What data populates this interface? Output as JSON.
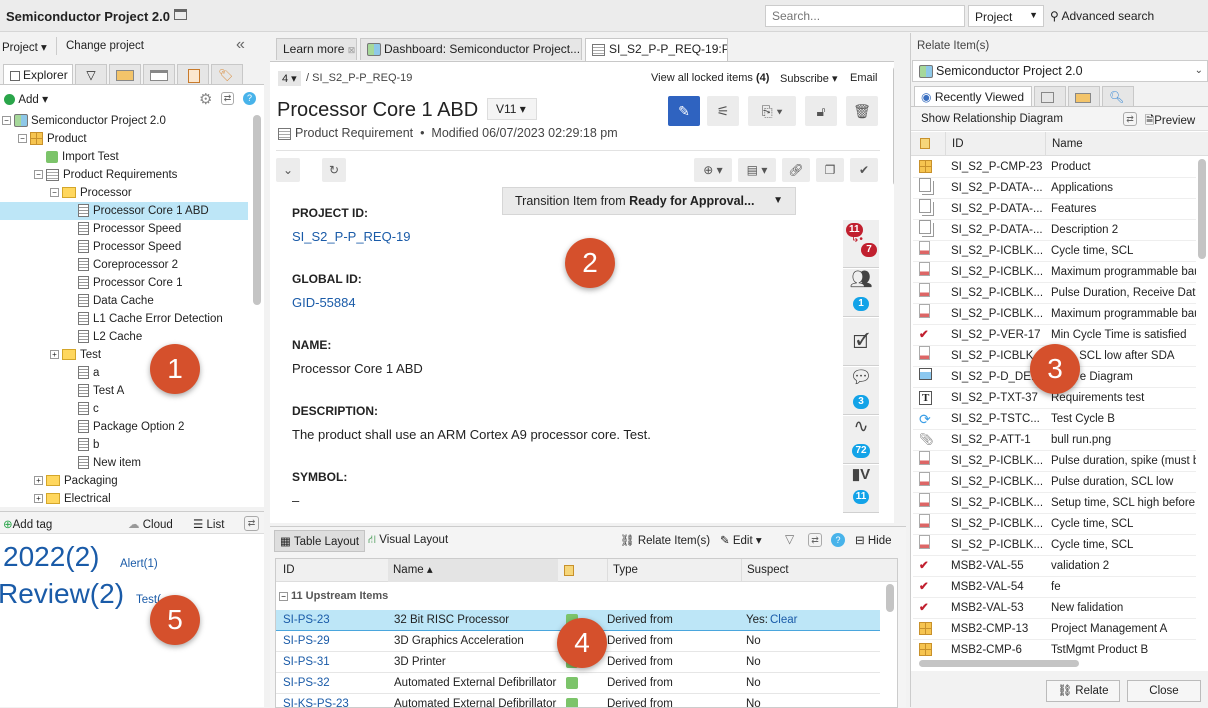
{
  "app": {
    "title": "Semiconductor Project 2.0",
    "search_placeholder": "Search...",
    "scope": "Project",
    "advanced_search": "Advanced search"
  },
  "left": {
    "project_menu": "Project",
    "change_project": "Change project",
    "tabs": [
      {
        "label": "Explorer"
      }
    ],
    "add": "Add",
    "tree": [
      {
        "label": "Semiconductor Project 2.0",
        "level": 0,
        "icon": "project",
        "toggle": "-"
      },
      {
        "label": "Product",
        "level": 1,
        "icon": "component",
        "toggle": "-"
      },
      {
        "label": "Import Test",
        "level": 2,
        "icon": "puzzle",
        "toggle": ""
      },
      {
        "label": "Product Requirements",
        "level": 2,
        "icon": "requirement",
        "toggle": "-"
      },
      {
        "label": "Processor",
        "level": 3,
        "icon": "folder",
        "toggle": "-"
      },
      {
        "label": "Processor Core 1 ABD",
        "level": 4,
        "icon": "doc",
        "toggle": "",
        "selected": true
      },
      {
        "label": "Processor Speed",
        "level": 4,
        "icon": "doc",
        "toggle": ""
      },
      {
        "label": "Processor Speed",
        "level": 4,
        "icon": "doc",
        "toggle": ""
      },
      {
        "label": "Coreprocessor 2",
        "level": 4,
        "icon": "doc",
        "toggle": ""
      },
      {
        "label": "Processor Core 1",
        "level": 4,
        "icon": "doc",
        "toggle": ""
      },
      {
        "label": "Data Cache",
        "level": 4,
        "icon": "doc",
        "toggle": ""
      },
      {
        "label": "L1 Cache Error Detection",
        "level": 4,
        "icon": "doc",
        "toggle": ""
      },
      {
        "label": "L2 Cache",
        "level": 4,
        "icon": "doc",
        "toggle": ""
      },
      {
        "label": "Test",
        "level": 3,
        "icon": "folder",
        "toggle": "+"
      },
      {
        "label": "a",
        "level": 4,
        "icon": "doc",
        "toggle": ""
      },
      {
        "label": "Test A",
        "level": 4,
        "icon": "doc",
        "toggle": ""
      },
      {
        "label": "c",
        "level": 4,
        "icon": "doc",
        "toggle": ""
      },
      {
        "label": "Package Option 2",
        "level": 4,
        "icon": "doc",
        "toggle": ""
      },
      {
        "label": "b",
        "level": 4,
        "icon": "doc",
        "toggle": ""
      },
      {
        "label": "New item",
        "level": 4,
        "icon": "doc",
        "toggle": ""
      },
      {
        "label": "Packaging",
        "level": 2,
        "icon": "folder",
        "toggle": "+"
      },
      {
        "label": "Electrical",
        "level": 2,
        "icon": "folder",
        "toggle": "+"
      }
    ]
  },
  "tags": {
    "add_tag": "Add tag",
    "cloud": "Cloud",
    "list": "List",
    "items": [
      {
        "label": "2022(2)"
      },
      {
        "label": "Alert(1)"
      },
      {
        "label": "Review(2)"
      },
      {
        "label": "Test("
      }
    ]
  },
  "center": {
    "tabs": [
      {
        "label": "Learn more"
      },
      {
        "label": "Dashboard: Semiconductor Project..."
      },
      {
        "label": "SI_S2_P-P_REQ-19:Proce..."
      }
    ],
    "crumb_count": "4",
    "crumb": "SI_S2_P-P_REQ-19",
    "locked": "View all locked items",
    "locked_count": "(4)",
    "subscribe": "Subscribe",
    "email": "Email",
    "title": "Processor Core 1 ABD",
    "version": "V11",
    "item_type": "Product Requirement",
    "modified": "Modified 06/07/2023 02:29:18 pm",
    "transition_prefix": "Transition Item from ",
    "transition_state": "Ready for Approval...",
    "fields": [
      {
        "label": "PROJECT ID:",
        "value": "SI_S2_P-P_REQ-19",
        "link": true
      },
      {
        "label": "GLOBAL ID:",
        "value": "GID-55884",
        "link": true
      },
      {
        "label": "NAME:",
        "value": "Processor Core 1 ABD"
      },
      {
        "label": "DESCRIPTION:",
        "value": "The product shall use an ARM Cortex A9 processor core. Test."
      },
      {
        "label": "SYMBOL:",
        "value": "–"
      }
    ],
    "side_badges": {
      "upstream": "11",
      "downstream": "7",
      "users": "1",
      "comments": "3",
      "activity": "72",
      "versions": "11"
    }
  },
  "relations": {
    "table_layout": "Table Layout",
    "visual_layout": "Visual Layout",
    "relate": "Relate Item(s)",
    "edit": "Edit",
    "hide": "Hide",
    "columns": [
      "ID",
      "Name",
      "Type",
      "Suspect"
    ],
    "group": "11 Upstream Items",
    "rows": [
      {
        "id": "SI-PS-23",
        "name": "32 Bit RISC Processor",
        "type": "Derived from",
        "suspect": "Yes:",
        "clear": "Clear",
        "selected": true
      },
      {
        "id": "SI-PS-29",
        "name": "3D Graphics Acceleration",
        "type": "Derived from",
        "suspect": "No"
      },
      {
        "id": "SI-PS-31",
        "name": "3D Printer",
        "type": "Derived from",
        "suspect": "No"
      },
      {
        "id": "SI-PS-32",
        "name": "Automated External Defibrillator",
        "type": "Derived from",
        "suspect": "No"
      },
      {
        "id": "SI-KS-PS-23",
        "name": "Automated External Defibrillator",
        "type": "Derived from",
        "suspect": "No"
      }
    ]
  },
  "right": {
    "title": "Relate Item(s)",
    "project": "Semiconductor Project 2.0",
    "tab": "Recently Viewed",
    "show_diagram": "Show Relationship Diagram",
    "preview": "Preview",
    "columns": [
      "ID",
      "Name"
    ],
    "rows": [
      {
        "icon": "component",
        "id": "SI_S2_P-CMP-23",
        "name": "Product"
      },
      {
        "icon": "data",
        "id": "SI_S2_P-DATA-...",
        "name": "Applications"
      },
      {
        "icon": "data",
        "id": "SI_S2_P-DATA-...",
        "name": "Features"
      },
      {
        "icon": "data",
        "id": "SI_S2_P-DATA-...",
        "name": "Description 2"
      },
      {
        "icon": "block",
        "id": "SI_S2_P-ICBLK...",
        "name": "Cycle time, SCL"
      },
      {
        "icon": "block",
        "id": "SI_S2_P-ICBLK...",
        "name": "Maximum programmable bau"
      },
      {
        "icon": "block",
        "id": "SI_S2_P-ICBLK...",
        "name": "Pulse Duration, Receive Data"
      },
      {
        "icon": "block",
        "id": "SI_S2_P-ICBLK...",
        "name": "Maximum programmable bau"
      },
      {
        "icon": "check",
        "id": "SI_S2_P-VER-17",
        "name": "Min Cycle Time is satisfied"
      },
      {
        "icon": "block",
        "id": "SI_S2_P-ICBLK...",
        "name": "time, SCL low after SDA"
      },
      {
        "icon": "diagram",
        "id": "SI_S2_P-D_DE...",
        "name": "tecture Diagram"
      },
      {
        "icon": "text",
        "id": "SI_S2_P-TXT-37",
        "name": "Requirements test"
      },
      {
        "icon": "cycle",
        "id": "SI_S2_P-TSTC...",
        "name": "Test Cycle B"
      },
      {
        "icon": "attach",
        "id": "SI_S2_P-ATT-1",
        "name": "bull run.png"
      },
      {
        "icon": "block",
        "id": "SI_S2_P-ICBLK...",
        "name": "Pulse duration, spike (must b"
      },
      {
        "icon": "block",
        "id": "SI_S2_P-ICBLK...",
        "name": "Pulse duration, SCL low"
      },
      {
        "icon": "block",
        "id": "SI_S2_P-ICBLK...",
        "name": "Setup time, SCL high before"
      },
      {
        "icon": "block",
        "id": "SI_S2_P-ICBLK...",
        "name": "Cycle time, SCL"
      },
      {
        "icon": "block",
        "id": "SI_S2_P-ICBLK...",
        "name": "Cycle time, SCL"
      },
      {
        "icon": "check",
        "id": "MSB2-VAL-55",
        "name": "validation 2"
      },
      {
        "icon": "check",
        "id": "MSB2-VAL-54",
        "name": "fe"
      },
      {
        "icon": "check",
        "id": "MSB2-VAL-53",
        "name": "New falidation"
      },
      {
        "icon": "component",
        "id": "MSB2-CMP-13",
        "name": "Project Management A"
      },
      {
        "icon": "component",
        "id": "MSB2-CMP-6",
        "name": "TstMgmt Product B"
      }
    ],
    "relate_button": "Relate",
    "close_button": "Close"
  },
  "callouts": [
    "1",
    "2",
    "3",
    "4",
    "5"
  ],
  "colors": {
    "accent": "#2f63c0",
    "link": "#1a5ba8",
    "callout": "#d5502c",
    "selection": "#bde6f7",
    "badge": "#13a3e8",
    "badge_red": "#c1202f"
  }
}
